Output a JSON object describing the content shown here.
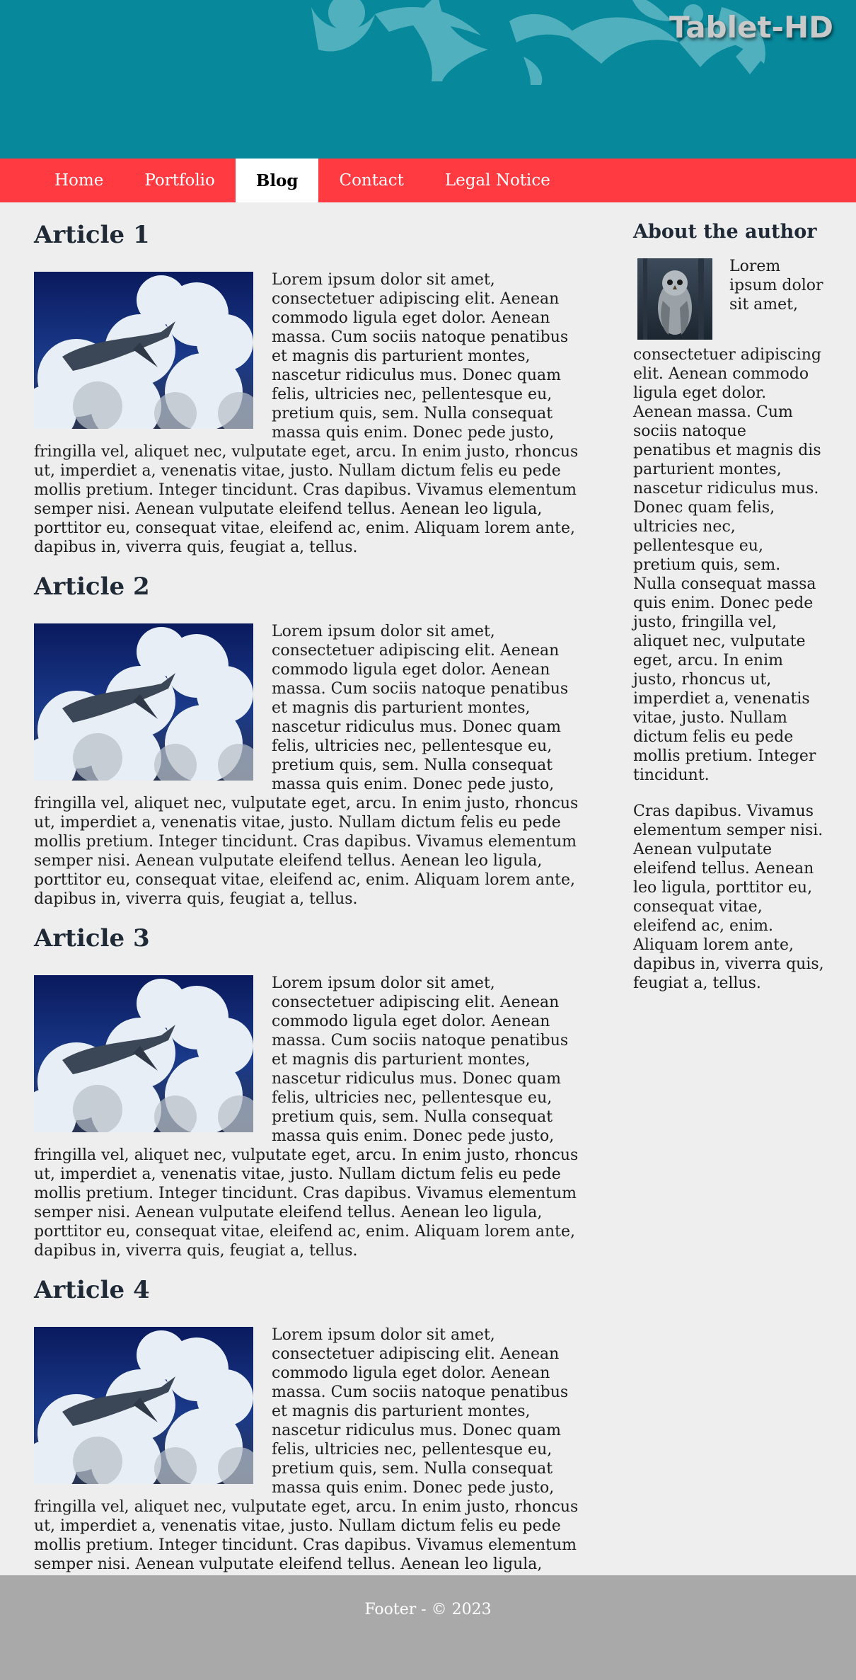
{
  "header": {
    "brand": "Tablet-HD",
    "bg_color": "#07889b"
  },
  "nav": {
    "bg_color": "#ff3a40",
    "items": [
      {
        "label": "Home"
      },
      {
        "label": "Portfolio"
      },
      {
        "label": "Blog",
        "active": true
      },
      {
        "label": "Contact"
      },
      {
        "label": "Legal Notice"
      }
    ]
  },
  "articles": [
    {
      "title": "Article 1",
      "image_icon": "flying-whale-clouds-image",
      "text": "Lorem ipsum dolor sit amet, consectetuer adipiscing elit. Aenean commodo ligula eget dolor. Aenean massa. Cum sociis natoque penatibus et magnis dis parturient montes, nascetur ridiculus mus. Donec quam felis, ultricies nec, pellentesque eu, pretium quis, sem. Nulla consequat massa quis enim. Donec pede justo, fringilla vel, aliquet nec, vulputate eget, arcu. In enim justo, rhoncus ut, imperdiet a, venenatis vitae, justo. Nullam dictum felis eu pede mollis pretium. Integer tincidunt. Cras dapibus. Vivamus elementum semper nisi. Aenean vulputate eleifend tellus. Aenean leo ligula, porttitor eu, consequat vitae, eleifend ac, enim. Aliquam lorem ante, dapibus in, viverra quis, feugiat a, tellus."
    },
    {
      "title": "Article 2",
      "image_icon": "flying-whale-clouds-image",
      "text": "Lorem ipsum dolor sit amet, consectetuer adipiscing elit. Aenean commodo ligula eget dolor. Aenean massa. Cum sociis natoque penatibus et magnis dis parturient montes, nascetur ridiculus mus. Donec quam felis, ultricies nec, pellentesque eu, pretium quis, sem. Nulla consequat massa quis enim. Donec pede justo, fringilla vel, aliquet nec, vulputate eget, arcu. In enim justo, rhoncus ut, imperdiet a, venenatis vitae, justo. Nullam dictum felis eu pede mollis pretium. Integer tincidunt. Cras dapibus. Vivamus elementum semper nisi. Aenean vulputate eleifend tellus. Aenean leo ligula, porttitor eu, consequat vitae, eleifend ac, enim. Aliquam lorem ante, dapibus in, viverra quis, feugiat a, tellus."
    },
    {
      "title": "Article 3",
      "image_icon": "flying-whale-clouds-image",
      "text": "Lorem ipsum dolor sit amet, consectetuer adipiscing elit. Aenean commodo ligula eget dolor. Aenean massa. Cum sociis natoque penatibus et magnis dis parturient montes, nascetur ridiculus mus. Donec quam felis, ultricies nec, pellentesque eu, pretium quis, sem. Nulla consequat massa quis enim. Donec pede justo, fringilla vel, aliquet nec, vulputate eget, arcu. In enim justo, rhoncus ut, imperdiet a, venenatis vitae, justo. Nullam dictum felis eu pede mollis pretium. Integer tincidunt. Cras dapibus. Vivamus elementum semper nisi. Aenean vulputate eleifend tellus. Aenean leo ligula, porttitor eu, consequat vitae, eleifend ac, enim. Aliquam lorem ante, dapibus in, viverra quis, feugiat a, tellus."
    },
    {
      "title": "Article 4",
      "image_icon": "flying-whale-clouds-image",
      "text": "Lorem ipsum dolor sit amet, consectetuer adipiscing elit. Aenean commodo ligula eget dolor. Aenean massa. Cum sociis natoque penatibus et magnis dis parturient montes, nascetur ridiculus mus. Donec quam felis, ultricies nec, pellentesque eu, pretium quis, sem. Nulla consequat massa quis enim. Donec pede justo, fringilla vel, aliquet nec, vulputate eget, arcu. In enim justo, rhoncus ut, imperdiet a, venenatis vitae, justo. Nullam dictum felis eu pede mollis pretium. Integer tincidunt. Cras dapibus. Vivamus elementum semper nisi. Aenean vulputate eleifend tellus. Aenean leo ligula, porttitor eu, consequat vitae, eleifend ac, enim. Aliquam lorem ante, dapibus in, viverra quis, feugiat a, tellus."
    }
  ],
  "sidebar": {
    "title": "About the author",
    "image_icon": "owl-portrait-image",
    "paragraph1": "Lorem ipsum dolor sit amet, consectetuer adipiscing elit. Aenean commodo ligula eget dolor. Aenean massa. Cum sociis natoque penatibus et magnis dis parturient montes, nascetur ridiculus mus. Donec quam felis, ultricies nec, pellentesque eu, pretium quis, sem. Nulla consequat massa quis enim. Donec pede justo, fringilla vel, aliquet nec, vulputate eget, arcu. In enim justo, rhoncus ut, imperdiet a, venenatis vitae, justo. Nullam dictum felis eu pede mollis pretium. Integer tincidunt.",
    "paragraph2": "Cras dapibus. Vivamus elementum semper nisi. Aenean vulputate eleifend tellus. Aenean leo ligula, porttitor eu, consequat vitae, eleifend ac, enim. Aliquam lorem ante, dapibus in, viverra quis, feugiat a, tellus."
  },
  "footer": {
    "text": "Footer - © 2023",
    "bg_color": "#a9a9a9"
  }
}
